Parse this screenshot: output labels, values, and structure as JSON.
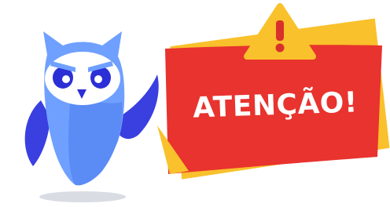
{
  "banner": {
    "text": "ATENÇÃO!",
    "colors": {
      "banner_red": "#E8332E",
      "banner_yellow": "#F9C12B",
      "warning_yellow": "#F9C12B",
      "warning_mark": "#D9302B"
    }
  },
  "mascot": {
    "icon": "owl-mascot",
    "colors": {
      "body_light": "#6FA0FF",
      "body_dark": "#3A3FE0",
      "face": "#ffffff",
      "eyes": "#2B2FD6",
      "beak": "#2B2FD6",
      "shadow": "#D9DCE3"
    }
  }
}
